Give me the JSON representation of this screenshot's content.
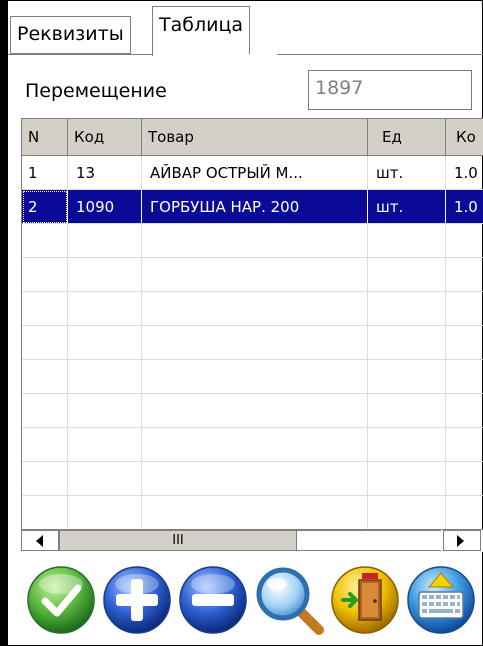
{
  "tabs": [
    {
      "label": "Реквизиты",
      "active": false
    },
    {
      "label": "Таблица",
      "active": true
    }
  ],
  "header": {
    "doc_label": "Перемещение",
    "doc_number": "1897"
  },
  "grid": {
    "columns": [
      "N",
      "Код",
      "Товар",
      "Ед",
      "Ко"
    ],
    "rows": [
      {
        "n": "1",
        "code": "13",
        "item": "АЙВАР ОСТРЫЙ М...",
        "unit": "шт.",
        "qty": "1.0",
        "selected": false
      },
      {
        "n": "2",
        "code": "1090",
        "item": "ГОРБУША НАР. 200",
        "unit": "шт.",
        "qty": "1.0",
        "selected": true
      }
    ]
  },
  "scrollbar": {
    "thumb_glyph": "III",
    "left_arrow": "left-arrow-icon",
    "right_arrow": "right-arrow-icon"
  },
  "toolbar": {
    "buttons": [
      {
        "name": "confirm-button",
        "icon": "checkmark-icon",
        "color": "#3aa03a"
      },
      {
        "name": "add-button",
        "icon": "plus-icon",
        "color": "#2a5cc8"
      },
      {
        "name": "remove-button",
        "icon": "minus-icon",
        "color": "#2a5cc8"
      },
      {
        "name": "search-button",
        "icon": "magnifier-icon",
        "color": "#2a8ad0"
      },
      {
        "name": "exit-button",
        "icon": "exit-door-icon",
        "color": "#e0b000"
      },
      {
        "name": "keyboard-button",
        "icon": "keyboard-icon",
        "color": "#2a8ad0"
      }
    ]
  },
  "colors": {
    "selection": "#0a0a96",
    "header_bg": "#d4d0c8",
    "grid_line": "#dcdcdc"
  }
}
